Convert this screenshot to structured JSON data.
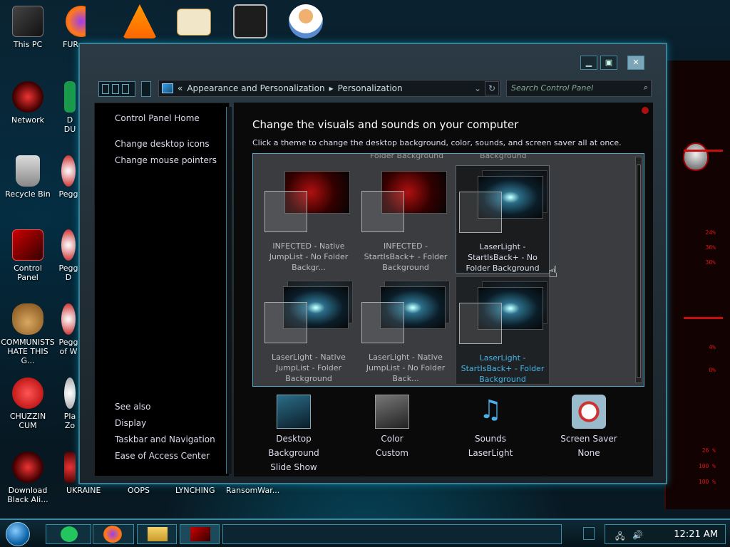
{
  "desktop": {
    "top_row_labels": [
      "This PC",
      "FUR"
    ],
    "left_icons": [
      {
        "label": "Network"
      },
      {
        "label": "Recycle Bin"
      },
      {
        "label": "Control Panel"
      },
      {
        "label": "COMMUNISTS HATE THIS G..."
      },
      {
        "label": "CHUZZIN CUM"
      },
      {
        "label": "Download Black Ali..."
      }
    ],
    "second_column": [
      "D DU",
      "Pegg",
      "Pegg D",
      "Pegg of W",
      "Pla Zo",
      "UKRAINE"
    ],
    "bottom_labels": [
      "OOPS",
      "LYNCHING",
      "RansomWar..."
    ],
    "side_percentages": [
      "24%",
      "36%",
      "30%",
      "4%",
      "0%",
      "26 %",
      "100 %",
      "100 %"
    ]
  },
  "window": {
    "breadcrumb": {
      "prefix": "«",
      "items": [
        "Appearance and Personalization",
        "Personalization"
      ]
    },
    "search_placeholder": "Search Control Panel",
    "left_pane": {
      "home": "Control Panel Home",
      "links": [
        "Change desktop icons",
        "Change mouse pointers"
      ],
      "see_also_title": "See also",
      "see_also": [
        "Display",
        "Taskbar and Navigation",
        "Ease of Access Center"
      ]
    },
    "heading": "Change the visuals and sounds on your computer",
    "subheading": "Click a theme to change the desktop background, color, sounds, and screen saver all at once.",
    "cut_labels": [
      "Folder Background",
      "Background"
    ],
    "themes": [
      {
        "label": "INFECTED - Native JumpList - No Folder Backgr..."
      },
      {
        "label": "INFECTED - StartIsBack+ - Folder Background"
      },
      {
        "label": "LaserLight - StartIsBack+ - No Folder Background"
      },
      {
        "label": "LaserLight - Native JumpList - Folder Background"
      },
      {
        "label": "LaserLight - Native JumpList - No Folder Back..."
      },
      {
        "label": "LaserLight - StartIsBack+ - Folder Background"
      }
    ],
    "bottom_items": [
      {
        "title": "Desktop Background",
        "value": "Slide Show"
      },
      {
        "title": "Color",
        "value": "Custom"
      },
      {
        "title": "Sounds",
        "value": "LaserLight"
      },
      {
        "title": "Screen Saver",
        "value": "None"
      }
    ]
  },
  "taskbar": {
    "clock": "12:21 AM"
  }
}
